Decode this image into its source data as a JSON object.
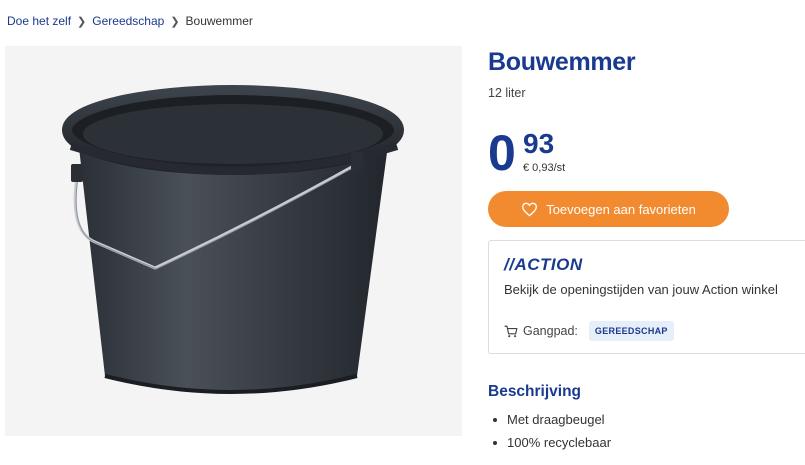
{
  "breadcrumb": {
    "items": [
      "Doe het zelf",
      "Gereedschap"
    ],
    "current": "Bouwemmer"
  },
  "product": {
    "title": "Bouwemmer",
    "subtitle": "12 liter",
    "price_int": "0",
    "price_dec": "93",
    "unit_price": "€ 0,93/st",
    "image_icon": "bucket-with-handle"
  },
  "favorites": {
    "label": "Toevoegen aan favorieten",
    "icon": "heart-icon"
  },
  "store": {
    "logo_text": "//ACTION",
    "hours_link": "Bekijk de openingstijden van jouw Action winkel",
    "aisle_label": "Gangpad:",
    "aisle_value": "GEREEDSCHAP",
    "aisle_icon": "cart-icon"
  },
  "description": {
    "title": "Beschrijving",
    "bullets": [
      "Met draagbeugel",
      "100% recyclebaar"
    ]
  },
  "colors": {
    "brand_blue": "#1a3a8f",
    "accent_orange": "#f28b30",
    "badge_bg": "#e6eef9"
  }
}
